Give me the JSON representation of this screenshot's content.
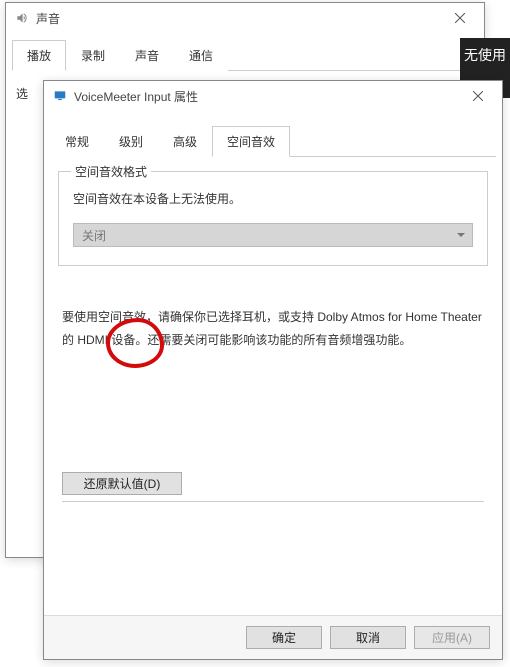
{
  "backWin": {
    "title": "声音",
    "tabs": [
      "播放",
      "录制",
      "声音",
      "通信"
    ],
    "sideLabel": "选"
  },
  "offscreen": {
    "text": "无使用"
  },
  "dialog": {
    "title": "VoiceMeeter Input 属性",
    "tabs": {
      "general": "常规",
      "levels": "级别",
      "advanced": "高级",
      "spatial": "空间音效"
    },
    "group": {
      "legend": "空间音效格式",
      "unavailable": "空间音效在本设备上无法使用。",
      "dropdown_value": "关闭"
    },
    "help": "要使用空间音效，请确保你已选择耳机，或支持 Dolby Atmos for Home Theater 的 HDMI 设备。还需要关闭可能影响该功能的所有音频增强功能。",
    "restore": "还原默认值(D)",
    "buttons": {
      "ok": "确定",
      "cancel": "取消",
      "apply": "应用(A)"
    }
  }
}
